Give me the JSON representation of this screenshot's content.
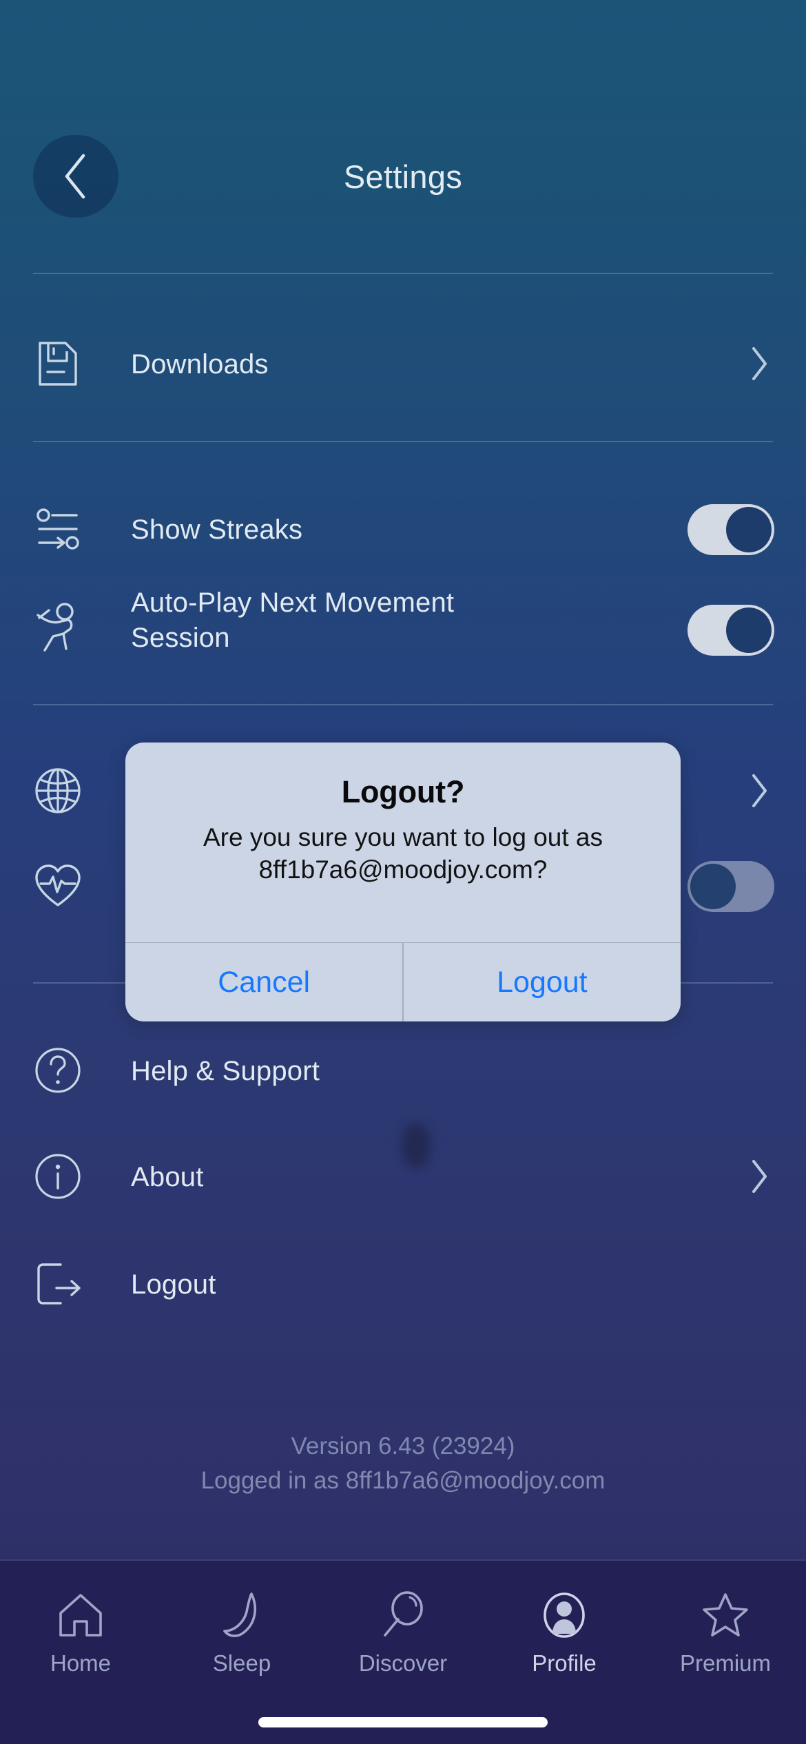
{
  "header": {
    "title": "Settings",
    "back_icon": "chevron-left-icon"
  },
  "sections": [
    {
      "items": [
        {
          "label": "Downloads",
          "icon": "download-file-icon",
          "accessory": "chevron"
        }
      ]
    },
    {
      "items": [
        {
          "label": "Show Streaks",
          "icon": "streaks-icon",
          "accessory": "toggle",
          "toggle_state": "on"
        },
        {
          "label": "Auto-Play Next Movement Session",
          "icon": "movement-person-icon",
          "accessory": "toggle",
          "toggle_state": "on"
        }
      ]
    },
    {
      "items": [
        {
          "label": "",
          "icon": "globe-icon",
          "accessory": "chevron"
        },
        {
          "label": "",
          "icon": "heart-pulse-icon",
          "accessory": "toggle",
          "toggle_state": "off"
        }
      ]
    },
    {
      "items": [
        {
          "label": "Help & Support",
          "icon": "question-circle-icon",
          "accessory": "none"
        },
        {
          "label": "About",
          "icon": "info-circle-icon",
          "accessory": "chevron"
        },
        {
          "label": "Logout",
          "icon": "logout-arrow-icon",
          "accessory": "none"
        }
      ]
    }
  ],
  "footer": {
    "version": "Version 6.43 (23924)",
    "logged_in_as": "Logged in as 8ff1b7a6@moodjoy.com"
  },
  "dialog": {
    "title": "Logout?",
    "message_line1": "Are you sure you want to log out as",
    "message_line2": "8ff1b7a6@moodjoy.com?",
    "cancel_label": "Cancel",
    "confirm_label": "Logout",
    "accent_color": "#1678ff",
    "background_color": "#ccd5e6"
  },
  "tabbar": {
    "items": [
      {
        "label": "Home",
        "icon": "home-icon",
        "active": false
      },
      {
        "label": "Sleep",
        "icon": "moon-icon",
        "active": false
      },
      {
        "label": "Discover",
        "icon": "magnifier-icon",
        "active": false
      },
      {
        "label": "Profile",
        "icon": "person-circle-icon",
        "active": true
      },
      {
        "label": "Premium",
        "icon": "star-icon",
        "active": false
      }
    ]
  },
  "colors": {
    "gradient_top": "#1a5578",
    "gradient_bottom": "#2a2760",
    "tabbar_background": "#232055",
    "text_primary": "#e2eaf2",
    "toggle_track": "#d3dae4",
    "toggle_knob": "#1d3b6b"
  }
}
